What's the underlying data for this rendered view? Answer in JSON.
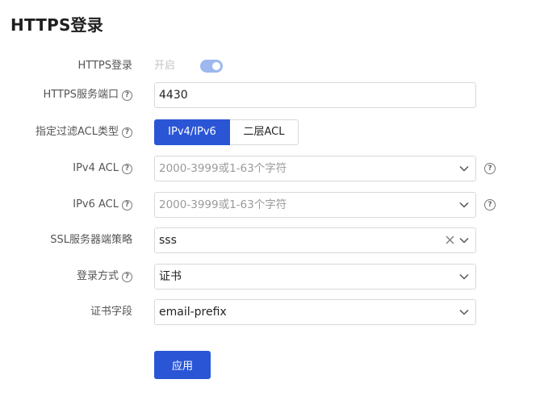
{
  "page": {
    "title": "HTTPS登录"
  },
  "form": {
    "https_login": {
      "label": "HTTPS登录",
      "status_text": "开启",
      "enabled": true
    },
    "port": {
      "label": "HTTPS服务端口",
      "value": "4430"
    },
    "acl_type": {
      "label": "指定过滤ACL类型",
      "options": [
        "IPv4/IPv6",
        "二层ACL"
      ],
      "selected": "IPv4/IPv6"
    },
    "ipv4_acl": {
      "label": "IPv4 ACL",
      "placeholder": "2000-3999或1-63个字符"
    },
    "ipv6_acl": {
      "label": "IPv6 ACL",
      "placeholder": "2000-3999或1-63个字符"
    },
    "ssl_policy": {
      "label": "SSL服务器端策略",
      "value": "sss"
    },
    "login_method": {
      "label": "登录方式",
      "value": "证书"
    },
    "cert_field": {
      "label": "证书字段",
      "value": "email-prefix"
    },
    "apply_label": "应用"
  },
  "icons": {
    "help": "question-circle-icon",
    "dropdown": "chevron-down-icon",
    "clear": "close-icon"
  },
  "colors": {
    "primary": "#2a56d6",
    "toggle_on": "#9db7ef"
  },
  "glyphs": {
    "help": "?"
  }
}
